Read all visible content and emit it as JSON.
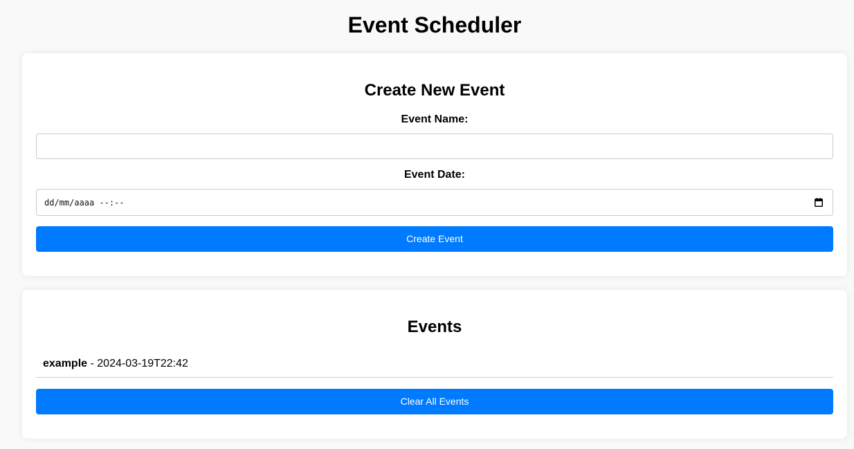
{
  "app": {
    "title": "Event Scheduler"
  },
  "create_form": {
    "heading": "Create New Event",
    "name_label": "Event Name:",
    "name_value": "",
    "date_label": "Event Date:",
    "date_placeholder": "dd/mm/aaaa --:--",
    "date_icon": "calendar-icon",
    "submit_label": "Create Event"
  },
  "events": {
    "heading": "Events",
    "items": [
      {
        "name": "example",
        "separator": " - ",
        "datetime": "2024-03-19T22:42"
      }
    ],
    "clear_label": "Clear All Events"
  },
  "colors": {
    "primary": "#007bff",
    "border": "#cccccc",
    "background": "#f9f9f9",
    "card": "#ffffff"
  }
}
